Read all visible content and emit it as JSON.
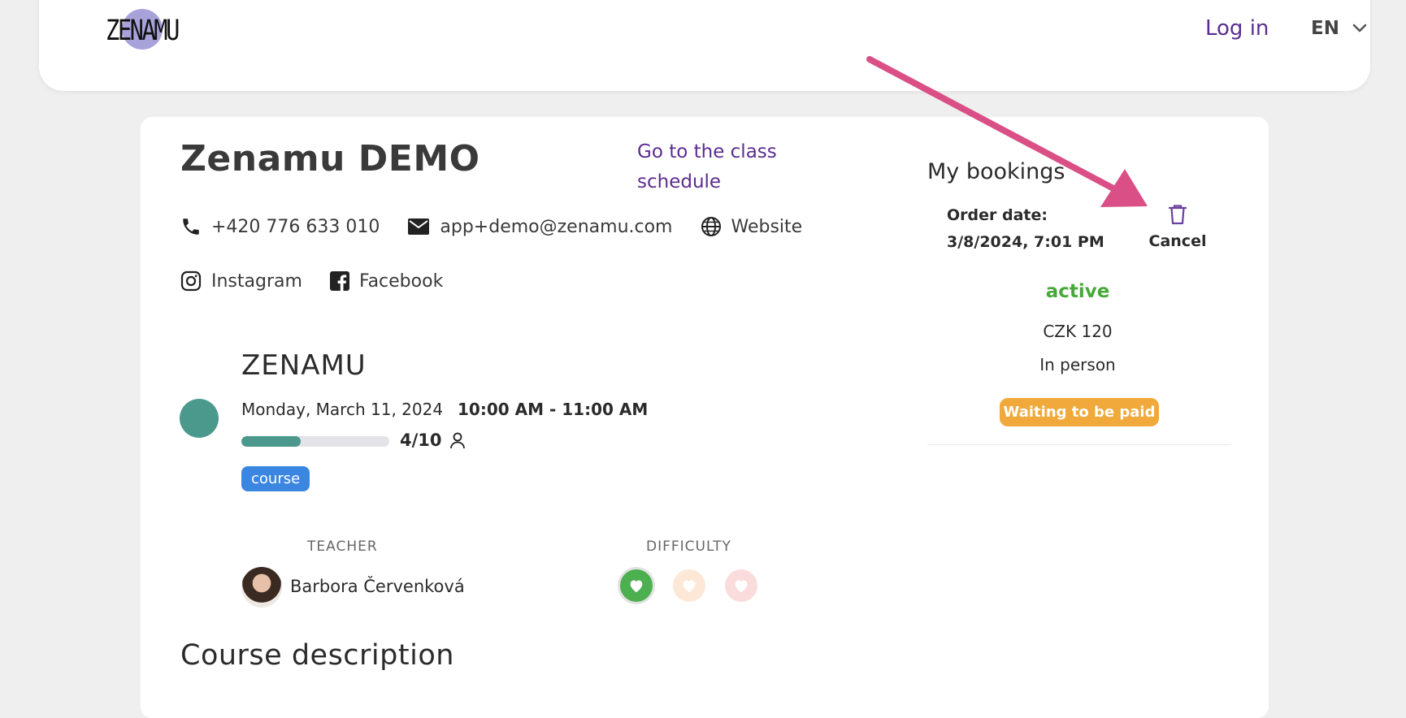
{
  "header": {
    "logo_text": "ZENAMU",
    "login_label": "Log in",
    "language": "EN"
  },
  "studio": {
    "title": "Zenamu DEMO",
    "schedule_link": "Go to the class schedule",
    "phone": "+420 776 633 010",
    "email": "app+demo@zenamu.com",
    "website": "Website",
    "instagram": "Instagram",
    "facebook": "Facebook"
  },
  "class": {
    "name": "ZENAMU",
    "date": "Monday, March 11, 2024",
    "time": "10:00 AM - 11:00 AM",
    "capacity": "4/10",
    "occupancy_fraction": 0.4,
    "tag": "course",
    "teacher_label": "TEACHER",
    "teacher_name": "Barbora Červenková",
    "difficulty_label": "DIFFICULTY",
    "difficulty_level": 1
  },
  "course_description_title": "Course description",
  "bookings": {
    "title": "My bookings",
    "order_date_label": "Order date:",
    "order_date_value": "3/8/2024, 7:01 PM",
    "cancel_label": "Cancel",
    "status": "active",
    "price": "CZK 120",
    "mode": "In person",
    "payment_status": "Waiting to be paid"
  },
  "colors": {
    "accent_purple": "#5b2d8f",
    "class_teal": "#4a998c",
    "active_green": "#48a83a",
    "badge_orange": "#f0a93a",
    "tag_blue": "#3b86e0",
    "annotation_arrow": "#d94f86"
  }
}
